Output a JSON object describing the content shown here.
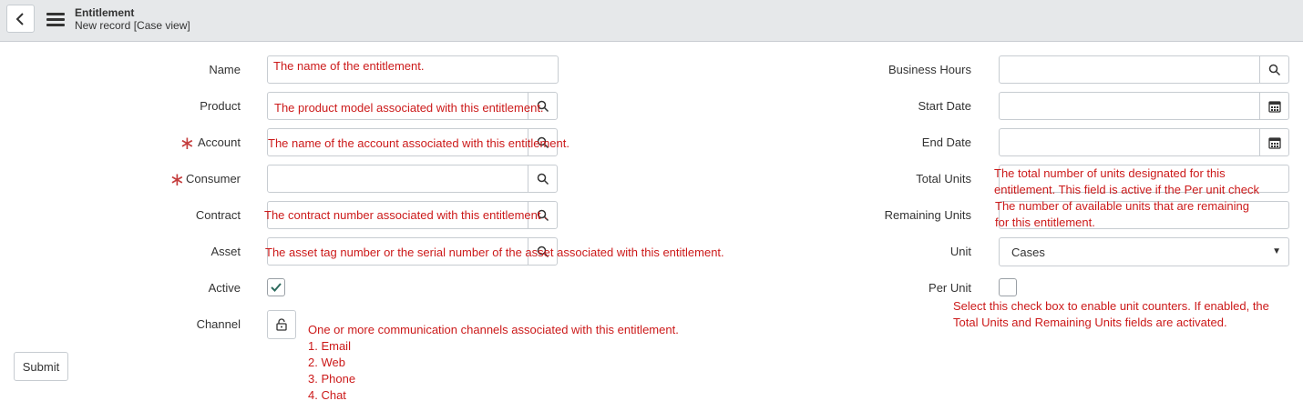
{
  "header": {
    "title": "Entitlement",
    "subtitle": "New record [Case view]"
  },
  "left_fields": {
    "name": {
      "label": "Name",
      "annotation": "The name of the entitlement."
    },
    "product": {
      "label": "Product",
      "annotation": "The product model associated with this entitlement."
    },
    "account": {
      "label": "Account",
      "required_mark": "∗",
      "annotation": "The name of the account associated with this entitlement."
    },
    "consumer": {
      "label": "Consumer",
      "required_mark": "∗"
    },
    "contract": {
      "label": "Contract",
      "annotation": "The contract number associated with this entitlement ."
    },
    "asset": {
      "label": "Asset",
      "annotation": "The asset tag number or the serial number of the asset associated with this entitlement."
    },
    "active": {
      "label": "Active",
      "checked": true
    },
    "channel": {
      "label": "Channel",
      "annotation": "One or more communication channels associated with this entitlement.",
      "options": [
        "1. Email",
        "2. Web",
        "3. Phone",
        "4. Chat"
      ]
    }
  },
  "right_fields": {
    "business_hours": {
      "label": "Business Hours"
    },
    "start_date": {
      "label": "Start Date"
    },
    "end_date": {
      "label": "End Date"
    },
    "total_units": {
      "label": "Total Units",
      "annotation_line1": "The total number of units designated for this",
      "annotation_line2": "entitlement. This field is active if the Per unit check"
    },
    "remaining_units": {
      "label": "Remaining Units",
      "annotation_line1": "The number of available units that are remaining",
      "annotation_line2": "for this entitlement."
    },
    "unit": {
      "label": "Unit",
      "selected": "Cases"
    },
    "per_unit": {
      "label": "Per Unit",
      "checked": false,
      "annotation_line1": "Select this check box to enable unit counters. If enabled, the",
      "annotation_line2": "Total Units and Remaining Units fields are activated."
    }
  },
  "actions": {
    "submit_label": "Submit"
  },
  "colors": {
    "annotation": "#cc1a1a",
    "required": "#c43c3c",
    "header_bg": "#e6e8ea"
  }
}
